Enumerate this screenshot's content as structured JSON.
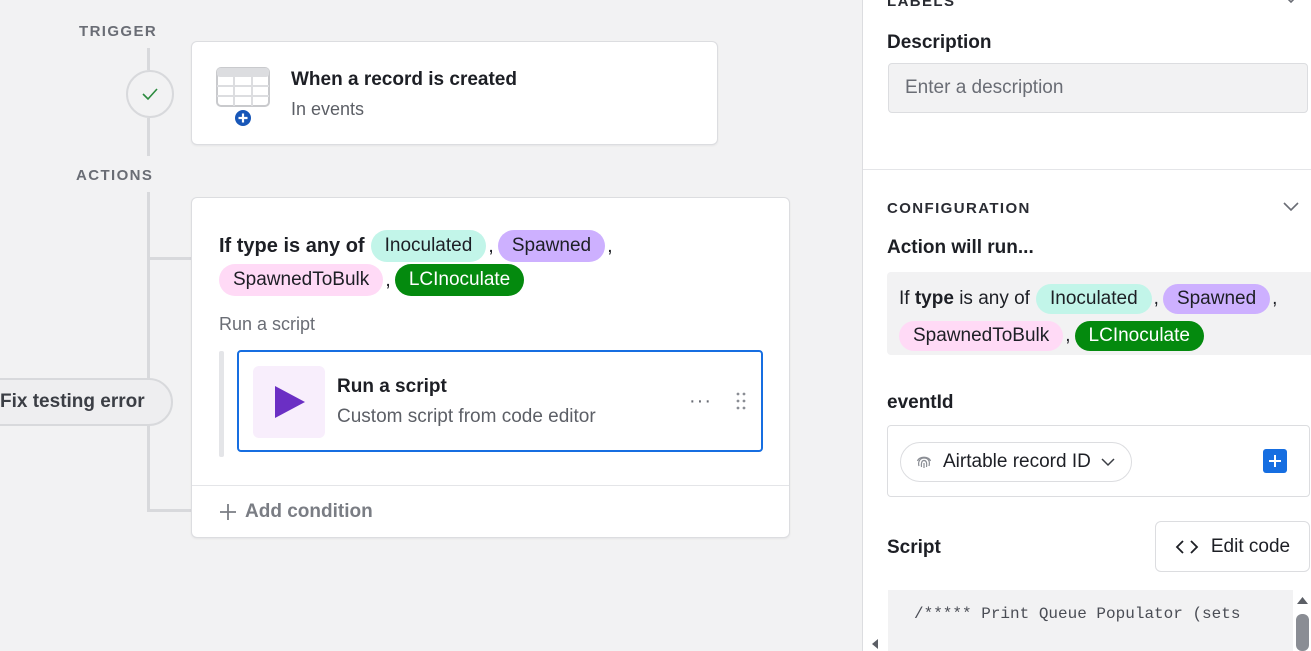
{
  "canvas": {
    "trigger_label": "TRIGGER",
    "actions_label": "ACTIONS",
    "trigger_card": {
      "title": "When a record is created",
      "subtitle": "In events"
    },
    "condition": {
      "prefix": "If type is any of",
      "pills": [
        {
          "text": "Inoculated",
          "bg": "#c2f5e9",
          "fg": "#1d1f25"
        },
        {
          "text": "Spawned",
          "bg": "#cdb0ff",
          "fg": "#1d1f25"
        },
        {
          "text": "SpawnedToBulk",
          "bg": "#ffdaf6",
          "fg": "#1d1f25"
        },
        {
          "text": "LCInoculate",
          "bg": "#048a0e",
          "fg": "#ffffff"
        }
      ]
    },
    "run_label": "Run a script",
    "script_card": {
      "title": "Run a script",
      "subtitle": "Custom script from code editor",
      "more": "···"
    },
    "add_condition": "Add condition",
    "fix_error": "Fix testing error"
  },
  "panel": {
    "labels_header": "LABELS",
    "description_label": "Description",
    "description_placeholder": "Enter a description",
    "config_header": "CONFIGURATION",
    "action_will_run": "Action will run...",
    "summary": {
      "if": "If",
      "field": "type",
      "op": "is any of"
    },
    "eventid_label": "eventId",
    "record_chip": "Airtable record ID",
    "script_label": "Script",
    "edit_code": "Edit code",
    "code_first_line": "/***** Print Queue Populator (sets"
  },
  "colors": {
    "accent": "#166ee1",
    "play": "#6b2fc4"
  }
}
